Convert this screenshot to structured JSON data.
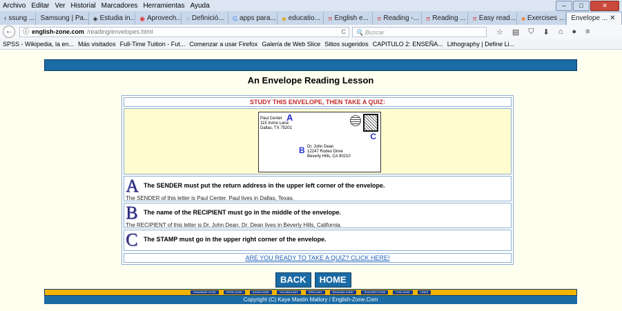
{
  "menu": [
    "Archivo",
    "Editar",
    "Ver",
    "Historial",
    "Marcadores",
    "Herramientas",
    "Ayuda"
  ],
  "tabs": [
    "ssung ...",
    "Samsung | Pa...",
    "Estudia in...",
    "Aprovech...",
    "Definició...",
    "apps para...",
    "educatio...",
    "English e...",
    "Reading -...",
    "Reading ...",
    "Easy read...",
    "Exercises ...",
    "Envelope ..."
  ],
  "url": {
    "domain": "english-zone.com",
    "path": "/reading/envelopes.html"
  },
  "search_placeholder": "Buscar",
  "bookmarks": [
    "SPSS - Wikipedia, la en...",
    "Más visitados",
    "Full-Time Tuition - Fut...",
    "Comenzar a usar Firefox",
    "Galería de Web Slice",
    "Sitios sugeridos",
    "CAPITULO 2: ENSEÑA...",
    "Lithography | Define Li..."
  ],
  "page": {
    "title": "An Envelope Reading Lesson",
    "study": "STUDY THIS ENVELOPE, THEN TAKE A QUIZ:",
    "envelope": {
      "return_address": [
        "Paul Center",
        "115 Irvine Lane",
        "Dallas, TX 75201"
      ],
      "recipient_address": [
        "Dr. John Dean",
        "12247 Rodeo Drive",
        "Beverly Hills, CA 90210"
      ],
      "label_a": "A",
      "label_b": "B",
      "label_c": "C"
    },
    "rows": [
      {
        "letter": "A",
        "heading": "The SENDER must put the return address in the upper left corner of the envelope.",
        "sub": "The SENDER of this letter is Paul Center. Paul lives in Dallas, Texas."
      },
      {
        "letter": "B",
        "heading": "The name of the RECIPIENT must go in the middle of the envelope.",
        "sub": "The RECIPIENT of this letter is Dr. John Dean. Dr. Dean lives in Beverly Hills, California."
      },
      {
        "letter": "C",
        "heading": "The STAMP must go in the upper right corner of the envelope.",
        "sub": ""
      }
    ],
    "quiz_link": "ARE YOU READY TO TAKE A QUIZ? CLICK HERE!",
    "back": "BACK",
    "home": "HOME",
    "zones": [
      "GRAMMAR ZONE",
      "VERB ZONE",
      "IDIOM ZONE",
      "VOCABULARY",
      "SPELLING",
      "READING ZONE",
      "TEACHER ZONE",
      "FUN ZONE",
      "LINKS"
    ],
    "copyright": "Copyright (C) Kaye Mastin Mallory / English-Zone.Com"
  }
}
